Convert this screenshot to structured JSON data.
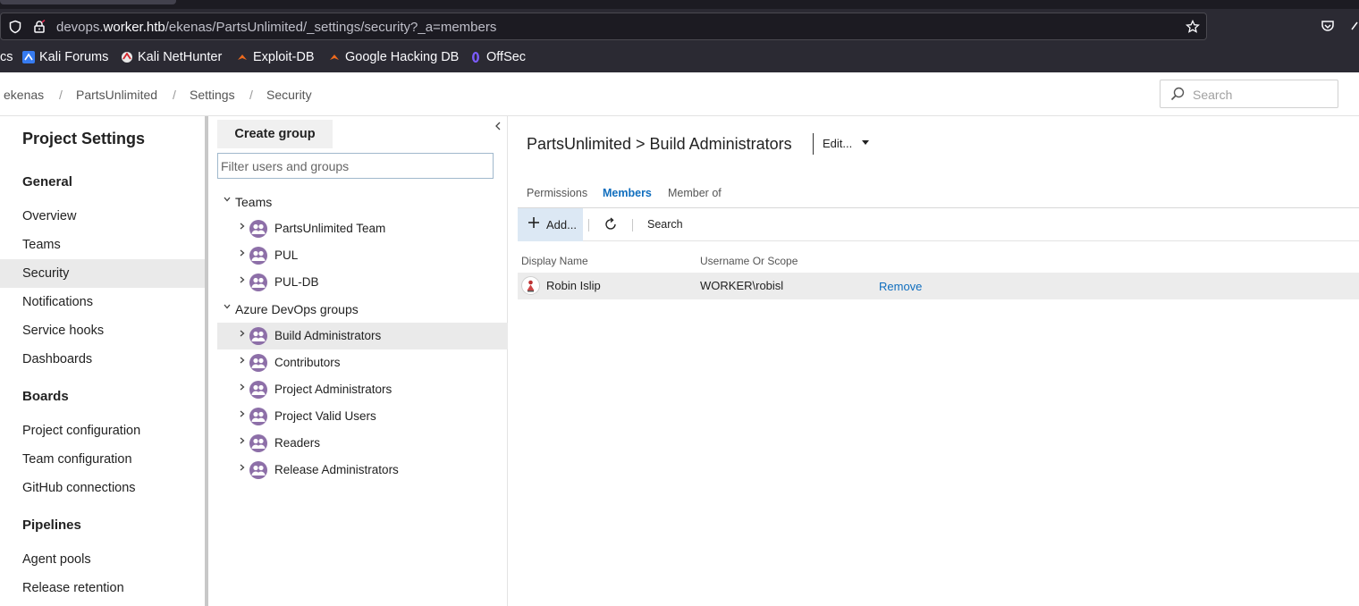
{
  "browser": {
    "url_prefix": "devops.",
    "url_host": "worker.htb",
    "url_path": "/ekenas/PartsUnlimited/_settings/security?_a=members",
    "bookmarks": [
      {
        "label": "cs"
      },
      {
        "label": "Kali Forums"
      },
      {
        "label": "Kali NetHunter"
      },
      {
        "label": "Exploit-DB"
      },
      {
        "label": "Google Hacking DB"
      },
      {
        "label": "OffSec"
      }
    ]
  },
  "header": {
    "breadcrumb": [
      "ekenas",
      "PartsUnlimited",
      "Settings",
      "Security"
    ],
    "search_placeholder": "Search"
  },
  "leftnav": {
    "title": "Project Settings",
    "sections": [
      {
        "label": "General",
        "items": [
          "Overview",
          "Teams",
          "Security",
          "Notifications",
          "Service hooks",
          "Dashboards"
        ]
      },
      {
        "label": "Boards",
        "items": [
          "Project configuration",
          "Team configuration",
          "GitHub connections"
        ]
      },
      {
        "label": "Pipelines",
        "items": [
          "Agent pools",
          "Release retention"
        ]
      }
    ],
    "selected": "Security"
  },
  "groups": {
    "create_label": "Create group",
    "filter_placeholder": "Filter users and groups",
    "teams_label": "Teams",
    "teams": [
      "PartsUnlimited Team",
      "PUL",
      "PUL-DB"
    ],
    "devops_label": "Azure DevOps groups",
    "devops_groups": [
      "Build Administrators",
      "Contributors",
      "Project Administrators",
      "Project Valid Users",
      "Readers",
      "Release Administrators"
    ],
    "selected": "Build Administrators"
  },
  "main": {
    "title": "PartsUnlimited > Build Administrators",
    "edit_label": "Edit...",
    "tabs": [
      "Permissions",
      "Members",
      "Member of"
    ],
    "active_tab": "Members",
    "toolbar": {
      "add_label": "Add...",
      "search_label": "Search"
    },
    "columns": [
      "Display Name",
      "Username Or Scope"
    ],
    "members": [
      {
        "display_name": "Robin Islip",
        "username": "WORKER\\robisl",
        "action": "Remove"
      }
    ]
  },
  "colors": {
    "accent": "#106ebe",
    "group_icon": "#8d6fa8",
    "chrome": "#2b2a33"
  }
}
